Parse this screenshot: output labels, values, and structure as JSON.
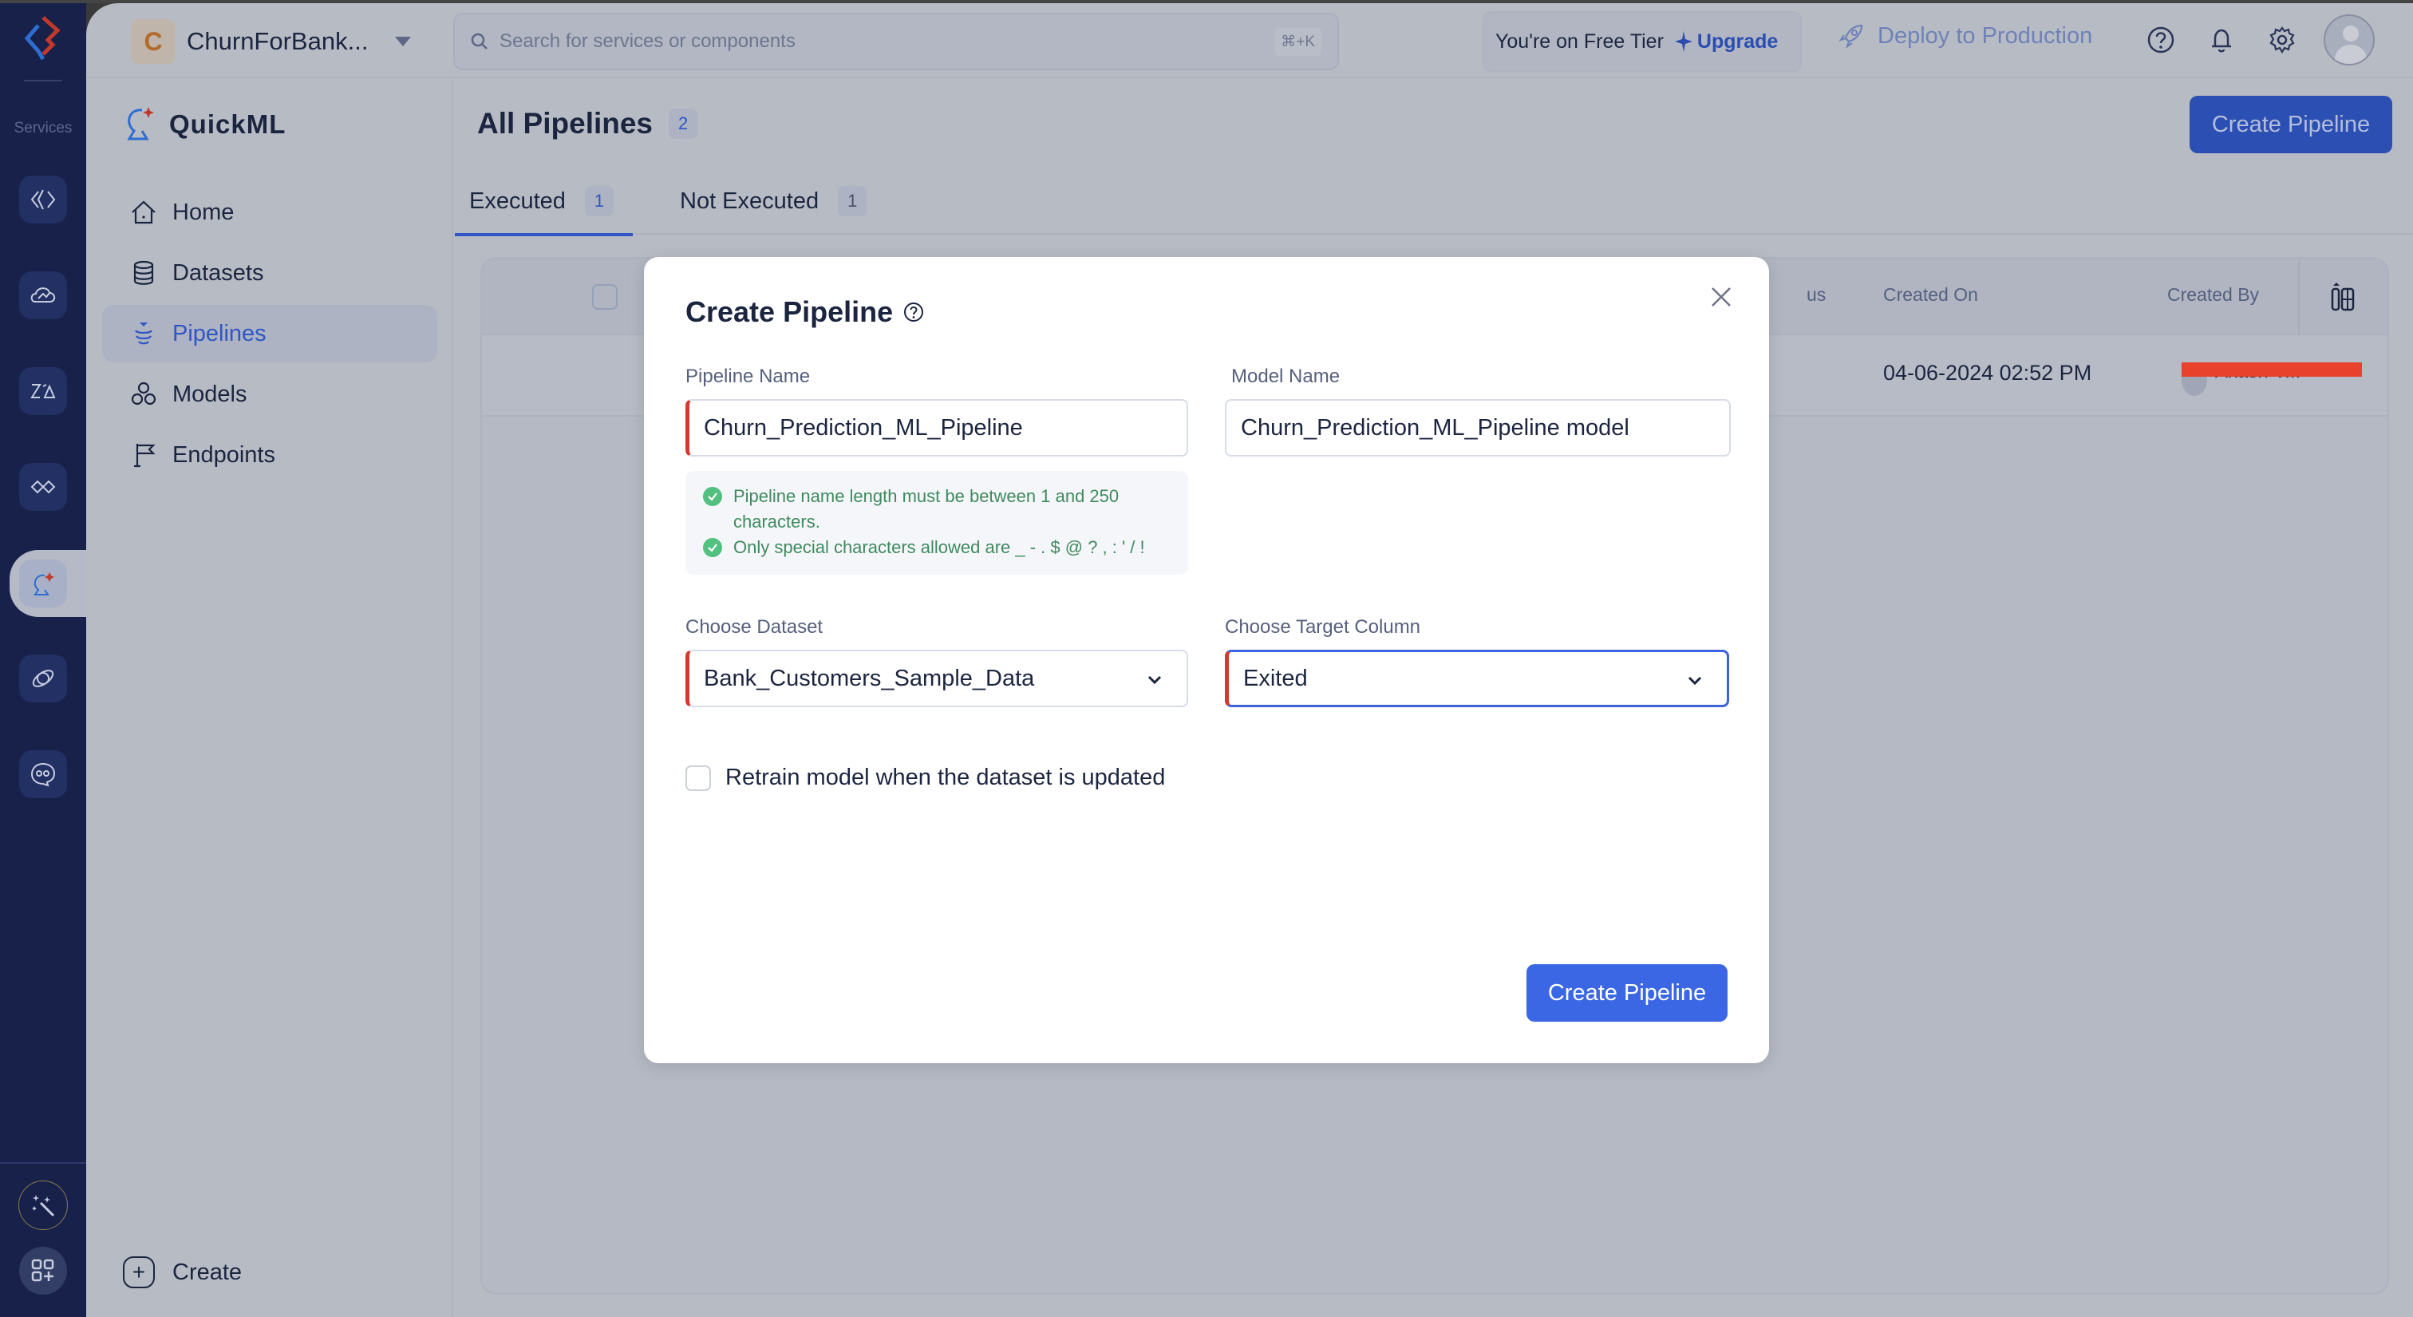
{
  "rail": {
    "services_label": "Services",
    "items": [
      {
        "icon": "code-icon"
      },
      {
        "icon": "cloud-icon"
      },
      {
        "icon": "zia-icon"
      },
      {
        "icon": "integration-icon"
      },
      {
        "icon": "quickml-icon",
        "active": true
      },
      {
        "icon": "orbit-icon"
      },
      {
        "icon": "chatbot-icon"
      }
    ]
  },
  "header": {
    "project_initial": "C",
    "project_name": "ChurnForBank...",
    "search_placeholder": "Search for services or components",
    "search_shortcut": "⌘+K",
    "tier_text": "You're on Free Tier",
    "upgrade_label": "Upgrade",
    "deploy_label": "Deploy to Production"
  },
  "nav": {
    "brand": "QuickML",
    "items": [
      {
        "label": "Home",
        "icon": "home-icon"
      },
      {
        "label": "Datasets",
        "icon": "database-icon"
      },
      {
        "label": "Pipelines",
        "icon": "pipeline-icon",
        "active": true
      },
      {
        "label": "Models",
        "icon": "models-icon"
      },
      {
        "label": "Endpoints",
        "icon": "flag-icon"
      }
    ],
    "create_label": "Create"
  },
  "main": {
    "title": "All Pipelines",
    "total_count": "2",
    "create_button": "Create Pipeline",
    "tabs": [
      {
        "label": "Executed",
        "count": "1",
        "active": true
      },
      {
        "label": "Not Executed",
        "count": "1"
      }
    ],
    "table": {
      "columns": [
        "us",
        "Created On",
        "Created By"
      ],
      "rows": [
        {
          "created_on": "04-06-2024 02:52 PM",
          "created_by": "Akash V..."
        }
      ]
    }
  },
  "modal": {
    "title": "Create Pipeline",
    "pipeline_name_label": "Pipeline Name",
    "pipeline_name_value": "Churn_Prediction_ML_Pipeline",
    "model_name_label": "Model Name",
    "model_name_value": "Churn_Prediction_ML_Pipeline model",
    "hints": [
      "Pipeline name length must be between 1 and 250 characters.",
      "Only special characters allowed are _ - . $ @ ? , : ' / !"
    ],
    "dataset_label": "Choose Dataset",
    "dataset_value": "Bank_Customers_Sample_Data",
    "target_label": "Choose Target Column",
    "target_value": "Exited",
    "retrain_label": "Retrain model when the dataset is updated",
    "retrain_checked": false,
    "submit_label": "Create Pipeline"
  },
  "colors": {
    "accent": "#3b66e4",
    "rail_bg": "#18214a",
    "required_marker": "#d33a2c",
    "hint_success": "#52c07e"
  }
}
